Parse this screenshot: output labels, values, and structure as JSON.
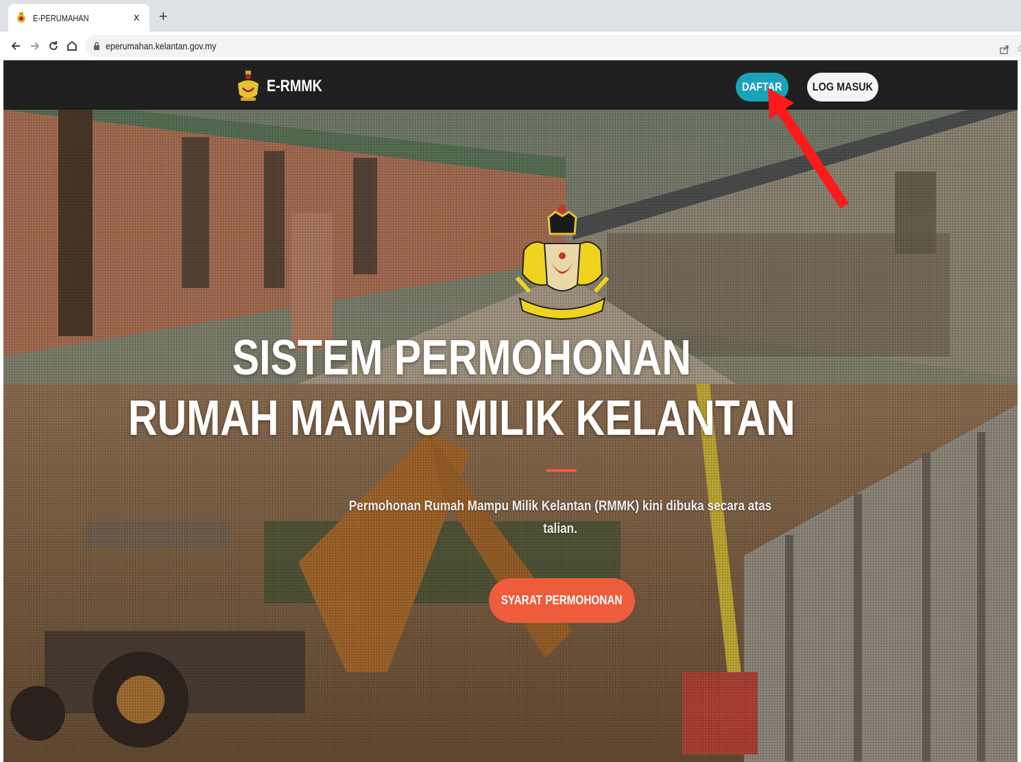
{
  "browser": {
    "tab_title": "E-PERUMAHAN",
    "tab_close": "x",
    "new_tab": "+",
    "url": "eperumahan.kelantan.gov.my",
    "icons": [
      "back-icon",
      "forward-icon",
      "reload-icon",
      "home-icon",
      "lock-icon",
      "share-icon",
      "star-icon"
    ]
  },
  "navbar": {
    "brand": "E-RMMK",
    "daftar_label": "DAFTAR",
    "login_label": "LOG MASUK"
  },
  "hero": {
    "title_line1": "SISTEM PERMOHONAN",
    "title_line2": "RUMAH MAMPU MILIK KELANTAN",
    "description": "Permohonan Rumah Mampu Milik Kelantan (RMMK) kini dibuka secara atas talian.",
    "cta_label": "SYARAT PERMOHONAN"
  },
  "colors": {
    "navbar_bg": "#1f1f1f",
    "daftar_bg": "#1aa3b8",
    "login_bg": "#f4f4f4",
    "accent": "#ef5c3c",
    "annotation_arrow": "#ff1a1a"
  }
}
